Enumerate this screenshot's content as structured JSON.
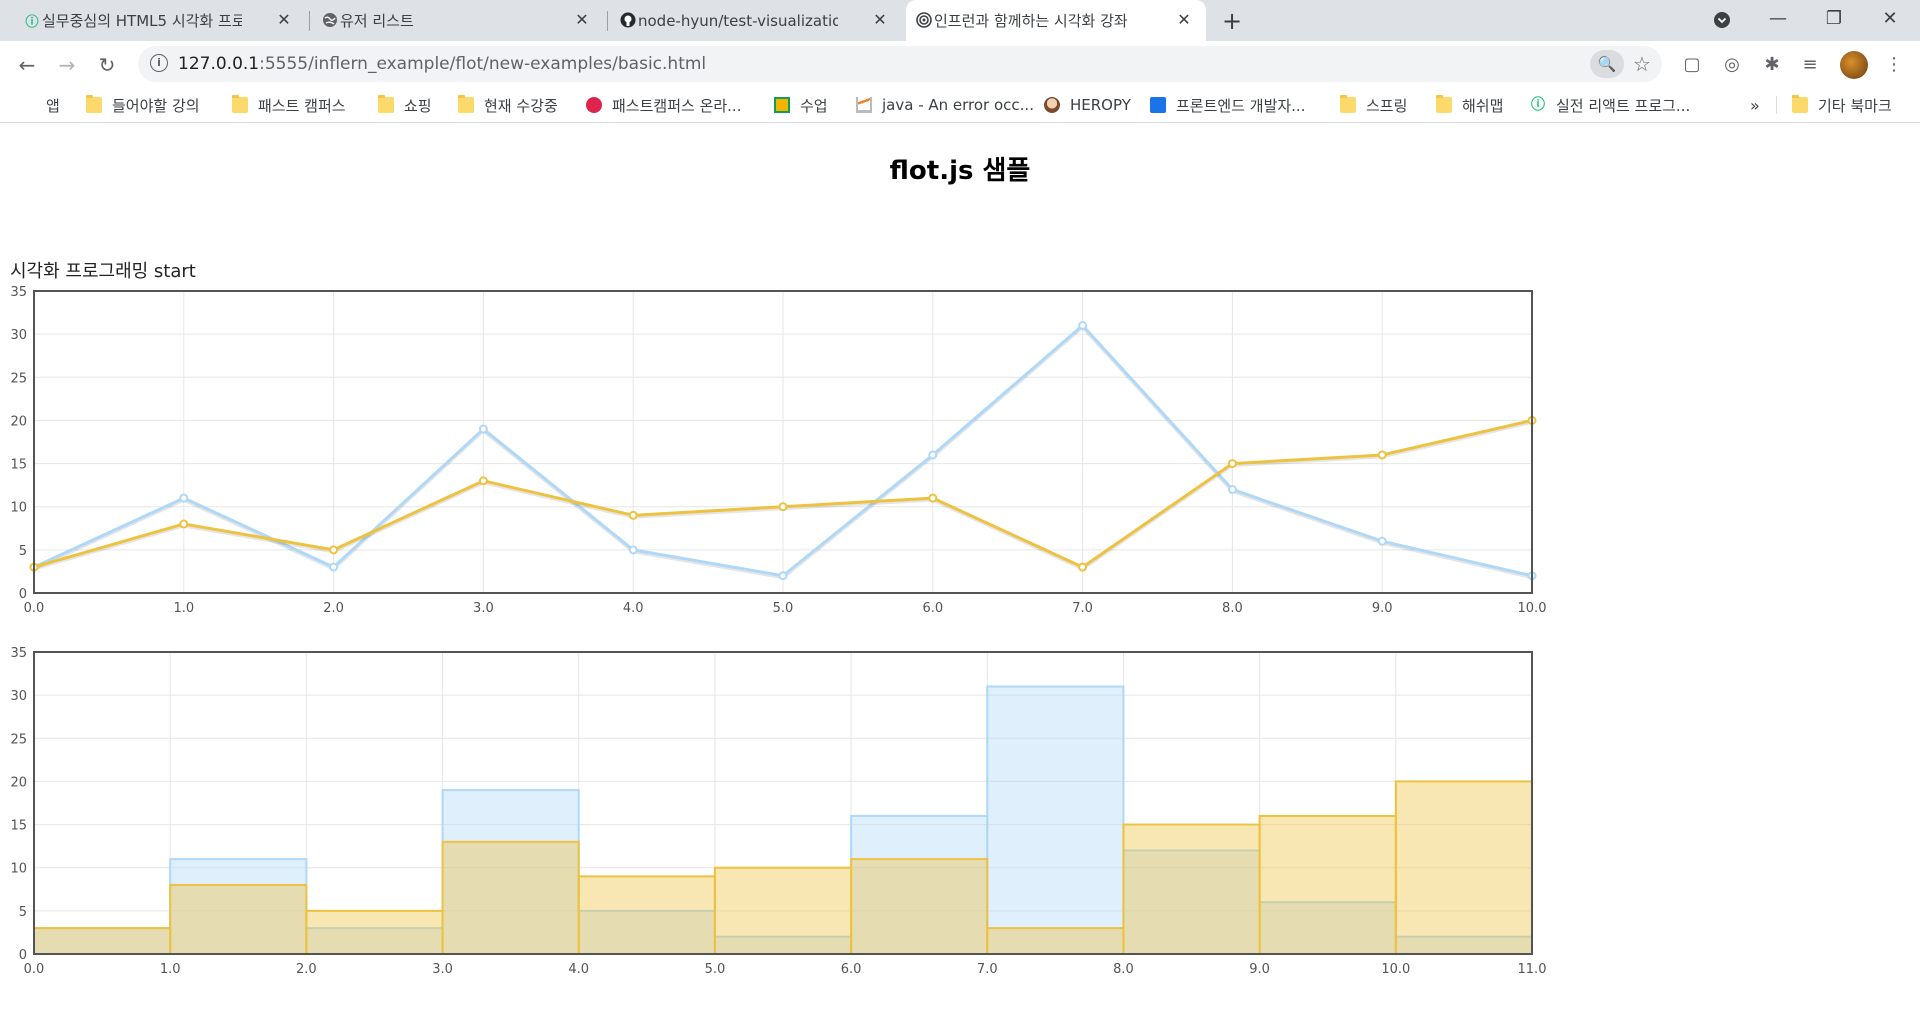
{
  "browser": {
    "tabs": [
      {
        "title": "실무중심의 HTML5 시각화 프로",
        "icon": "inflearn-icon",
        "active": false
      },
      {
        "title": "유저 리스트",
        "icon": "globe-icon",
        "active": false
      },
      {
        "title": "node-hyun/test-visualization: te",
        "icon": "github-icon",
        "active": false
      },
      {
        "title": "인프런과 함께하는 시각화 강좌",
        "icon": "webrtc-icon",
        "active": true
      }
    ],
    "new_tab": "+",
    "tab_close": "✕",
    "window_controls": {
      "minimize": "—",
      "restore": "❐",
      "close": "✕"
    },
    "url_host": "127.0.0.1",
    "url_path": ":5555/inflern_example/flot/new-examples/basic.html",
    "bookmarks": [
      {
        "label": "앱",
        "icon": "apps-icon"
      },
      {
        "label": "들어야할 강의",
        "icon": "folder-icon"
      },
      {
        "label": "패스트 캠퍼스",
        "icon": "folder-icon"
      },
      {
        "label": "쇼핑",
        "icon": "folder-icon"
      },
      {
        "label": "현재 수강중",
        "icon": "folder-icon"
      },
      {
        "label": "패스트캠퍼스 온라...",
        "icon": "fastcampus-icon"
      },
      {
        "label": "수업",
        "icon": "classroom-icon"
      },
      {
        "label": "java - An error occ...",
        "icon": "stackoverflow-icon"
      },
      {
        "label": "HEROPY",
        "icon": "avatar-icon"
      },
      {
        "label": "프론트엔드 개발자...",
        "icon": "profile-icon"
      },
      {
        "label": "스프링",
        "icon": "folder-icon"
      },
      {
        "label": "해쉬맵",
        "icon": "folder-icon"
      },
      {
        "label": "실전 리액트 프로그...",
        "icon": "inflearn-icon"
      }
    ],
    "bookmarks_more": "»",
    "other_bookmarks": "기타 북마크"
  },
  "page": {
    "title": "flot.js 샘플",
    "chart_caption": "시각화 프로그래밍 start"
  },
  "colors": {
    "series_a": "#afd8f8",
    "series_b": "#edc240"
  },
  "chart_data": [
    {
      "type": "line",
      "x": [
        0,
        1,
        2,
        3,
        4,
        5,
        6,
        7,
        8,
        9,
        10
      ],
      "series": [
        {
          "values": [
            3,
            11,
            3,
            19,
            5,
            2,
            16,
            31,
            12,
            6,
            2
          ]
        },
        {
          "values": [
            3,
            8,
            5,
            13,
            9,
            10,
            11,
            3,
            15,
            16,
            20
          ]
        }
      ],
      "xlim": [
        0,
        10
      ],
      "ylim": [
        0,
        35
      ],
      "xticks": [
        "0.0",
        "1.0",
        "2.0",
        "3.0",
        "4.0",
        "5.0",
        "6.0",
        "7.0",
        "8.0",
        "9.0",
        "10.0"
      ],
      "yticks": [
        "0",
        "5",
        "10",
        "15",
        "20",
        "25",
        "30",
        "35"
      ],
      "grid": true
    },
    {
      "type": "bar",
      "x": [
        0,
        1,
        2,
        3,
        4,
        5,
        6,
        7,
        8,
        9,
        10
      ],
      "series": [
        {
          "values": [
            3,
            11,
            3,
            19,
            5,
            2,
            16,
            31,
            12,
            6,
            2
          ]
        },
        {
          "values": [
            3,
            8,
            5,
            13,
            9,
            10,
            11,
            3,
            15,
            16,
            20
          ]
        }
      ],
      "xlim": [
        0,
        11
      ],
      "ylim": [
        0,
        35
      ],
      "xticks": [
        "0.0",
        "1.0",
        "2.0",
        "3.0",
        "4.0",
        "5.0",
        "6.0",
        "7.0",
        "8.0",
        "9.0",
        "10.0",
        "11.0"
      ],
      "yticks": [
        "0",
        "5",
        "10",
        "15",
        "20",
        "25",
        "30",
        "35"
      ],
      "grid": true
    }
  ]
}
